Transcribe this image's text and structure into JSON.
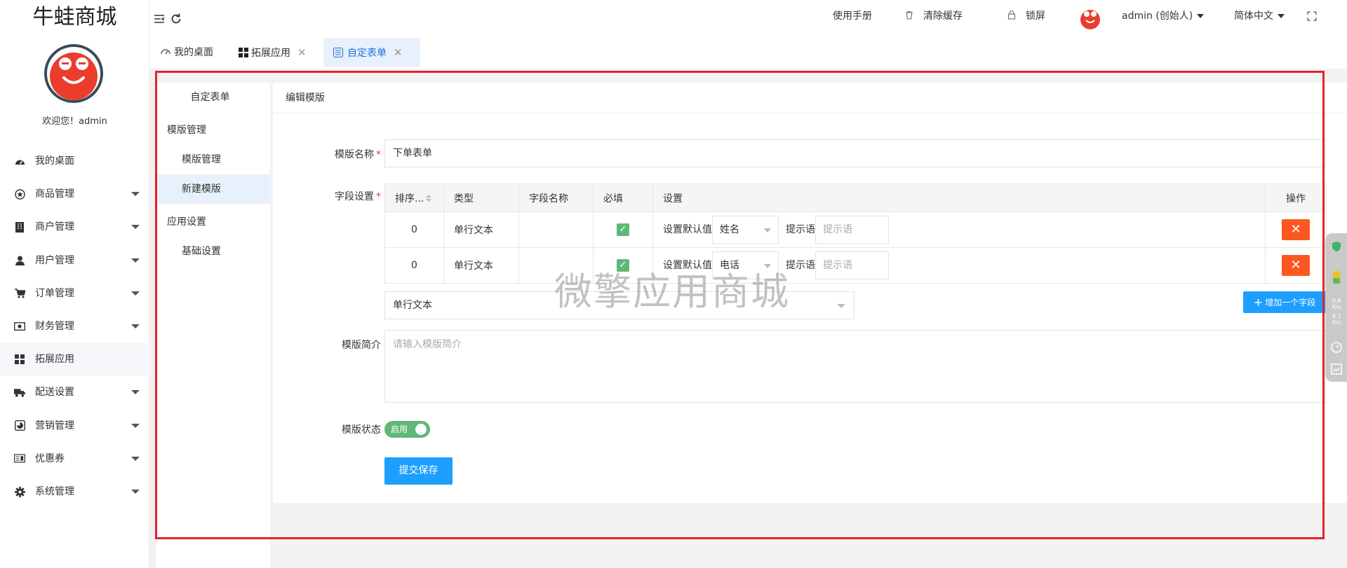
{
  "app": {
    "title": "牛蛙商城",
    "welcome": "欢迎您！admin"
  },
  "sidebar": {
    "items": [
      {
        "label": "我的桌面",
        "icon": "dashboard-icon",
        "has_submenu": false
      },
      {
        "label": "商品管理",
        "icon": "goods-icon",
        "has_submenu": true
      },
      {
        "label": "商户管理",
        "icon": "merchant-icon",
        "has_submenu": true
      },
      {
        "label": "用户管理",
        "icon": "user-icon",
        "has_submenu": true
      },
      {
        "label": "订单管理",
        "icon": "cart-icon",
        "has_submenu": true
      },
      {
        "label": "财务管理",
        "icon": "money-icon",
        "has_submenu": true
      },
      {
        "label": "拓展应用",
        "icon": "apps-icon",
        "has_submenu": false,
        "active": true
      },
      {
        "label": "配送设置",
        "icon": "truck-icon",
        "has_submenu": true
      },
      {
        "label": "营销管理",
        "icon": "marketing-icon",
        "has_submenu": true
      },
      {
        "label": "优惠券",
        "icon": "coupon-icon",
        "has_submenu": true
      },
      {
        "label": "系统管理",
        "icon": "gear-icon",
        "has_submenu": true
      }
    ]
  },
  "header": {
    "manual": "使用手册",
    "clear_cache": "清除缓存",
    "lock": "锁屏",
    "user": "admin (创始人)",
    "language": "简体中文"
  },
  "tabs": [
    {
      "label": "我的桌面",
      "closable": false
    },
    {
      "label": "拓展应用",
      "closable": true
    },
    {
      "label": "自定表单",
      "closable": true,
      "active": true
    }
  ],
  "sub_sidebar": {
    "title": "自定表单",
    "groups": [
      {
        "label": "模版管理",
        "items": [
          "模版管理",
          "新建模版"
        ]
      },
      {
        "label": "应用设置",
        "items": [
          "基础设置"
        ]
      }
    ]
  },
  "form": {
    "panel_title": "编辑模版",
    "name_label": "模版名称",
    "name_value": "下单表单",
    "fields_label": "字段设置",
    "columns": [
      "排序...",
      "类型",
      "字段名称",
      "必填",
      "设置",
      "操作"
    ],
    "rows": [
      {
        "order": "0",
        "type": "单行文本",
        "field_name": "",
        "required": true,
        "default_label": "设置默认值",
        "default_value": "姓名",
        "hint_label": "提示语",
        "hint_placeholder": "提示语"
      },
      {
        "order": "0",
        "type": "单行文本",
        "field_name": "",
        "required": true,
        "default_label": "设置默认值",
        "default_value": "电话",
        "hint_label": "提示语",
        "hint_placeholder": "提示语"
      }
    ],
    "new_field_type": "单行文本",
    "add_field_button": "增加一个字段",
    "desc_label": "模版简介",
    "desc_placeholder": "请输入模版简介",
    "status_label": "模版状态",
    "status_value": "启用",
    "submit": "提交保存"
  },
  "watermark": "微擎应用商城",
  "speed_widget": {
    "up": "0.8",
    "up_unit": "K/s",
    "down": "9.3",
    "down_unit": "K/s"
  },
  "colors": {
    "primary": "#1e9fff",
    "danger": "#ff5722",
    "success": "#5fb878",
    "highlight_frame": "#e8212b"
  }
}
